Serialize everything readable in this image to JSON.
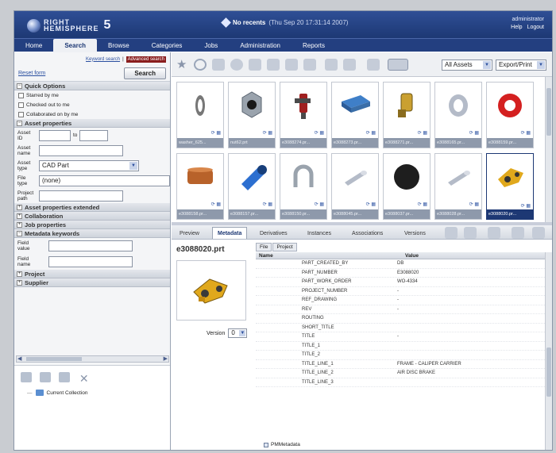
{
  "header": {
    "logo_text_1": "RIGHT",
    "logo_text_2": "HEMISPHERE",
    "logo_version": "5",
    "recent_label": "No recents",
    "recent_time": "(Thu Sep 20 17:31:14 2007)",
    "user": "administrator",
    "help": "Help",
    "logout": "Logout"
  },
  "nav": [
    "Home",
    "Search",
    "Browse",
    "Categories",
    "Jobs",
    "Administration",
    "Reports"
  ],
  "left": {
    "keyword_search": "Keyword search",
    "advanced_search": "Advanced search",
    "reset_form": "Reset form",
    "search_button": "Search",
    "sections": {
      "quick_options": "Quick Options",
      "asset_properties": "Asset properties",
      "asset_properties_extended": "Asset properties extended",
      "collaboration": "Collaboration",
      "job_properties": "Job properties",
      "metadata_keywords": "Metadata keywords",
      "project": "Project",
      "supplier": "Supplier"
    },
    "checkboxes": [
      "Starred by me",
      "Checked out to me",
      "Collaborated on by me"
    ],
    "asset_id_label": "Asset ID",
    "to_label": "to",
    "asset_name_label": "Asset name",
    "asset_type_label": "Asset type",
    "asset_type_value": "CAD Part",
    "file_type_label": "File type",
    "file_type_value": "(none)",
    "project_path_label": "Project path",
    "field_value_label": "Field value",
    "field_name_label": "Field name",
    "tree_item": "Current Collection"
  },
  "toolbar": {
    "filter_value": "All Assets",
    "export_value": "Export/Print"
  },
  "grid": {
    "rows": [
      [
        {
          "caption": "washer_625...",
          "shape": "washer"
        },
        {
          "caption": "nut62.prt",
          "shape": "nut"
        },
        {
          "caption": "e3088274.pr...",
          "shape": "tap"
        },
        {
          "caption": "e3088273.pr...",
          "shape": "block"
        },
        {
          "caption": "e3088271.pr...",
          "shape": "bracket"
        },
        {
          "caption": "e3088165.pr...",
          "shape": "ring"
        },
        {
          "caption": "e3088159.pr...",
          "shape": "redring"
        }
      ],
      [
        {
          "caption": "e3088158.pr...",
          "shape": "drum"
        },
        {
          "caption": "e3088157.pr...",
          "shape": "tube"
        },
        {
          "caption": "e3088150.pr...",
          "shape": "ubolt"
        },
        {
          "caption": "e3088045.pr...",
          "shape": "pin"
        },
        {
          "caption": "e3088037.pr...",
          "shape": "disc"
        },
        {
          "caption": "e3088028.pr...",
          "shape": "pin"
        },
        {
          "caption": "e3088020.pr...",
          "shape": "carrier"
        }
      ]
    ]
  },
  "tabs": [
    "Preview",
    "Metadata",
    "Derivatives",
    "Instances",
    "Associations",
    "Versions"
  ],
  "active_tab": "Metadata",
  "detail": {
    "filename": "e3088020.prt",
    "version_label": "Version",
    "version_value": "0",
    "prop_tabs": [
      "File",
      "Project"
    ],
    "col_name": "Name",
    "col_value": "Value",
    "rows": [
      {
        "name": "PART_CREATED_BY",
        "value": "DB"
      },
      {
        "name": "PART_NUMBER",
        "value": "E3088020"
      },
      {
        "name": "PART_WORK_ORDER",
        "value": "WO-4334"
      },
      {
        "name": "PROJECT_NUMBER",
        "value": "-"
      },
      {
        "name": "REF_DRAWING",
        "value": "-"
      },
      {
        "name": "REV",
        "value": "-"
      },
      {
        "name": "ROUTING",
        "value": ""
      },
      {
        "name": "SHORT_TITLE",
        "value": ""
      },
      {
        "name": "TITLE",
        "value": "-"
      },
      {
        "name": "TITLE_1",
        "value": ""
      },
      {
        "name": "TITLE_2",
        "value": ""
      },
      {
        "name": "TITLE_LINE_1",
        "value": "FRAME - CALIPER CARRIER"
      },
      {
        "name": "TITLE_LINE_2",
        "value": "AIR DISC BRAKE"
      },
      {
        "name": "TITLE_LINE_3",
        "value": ""
      }
    ],
    "pm_metadata": "PMMetadata"
  }
}
